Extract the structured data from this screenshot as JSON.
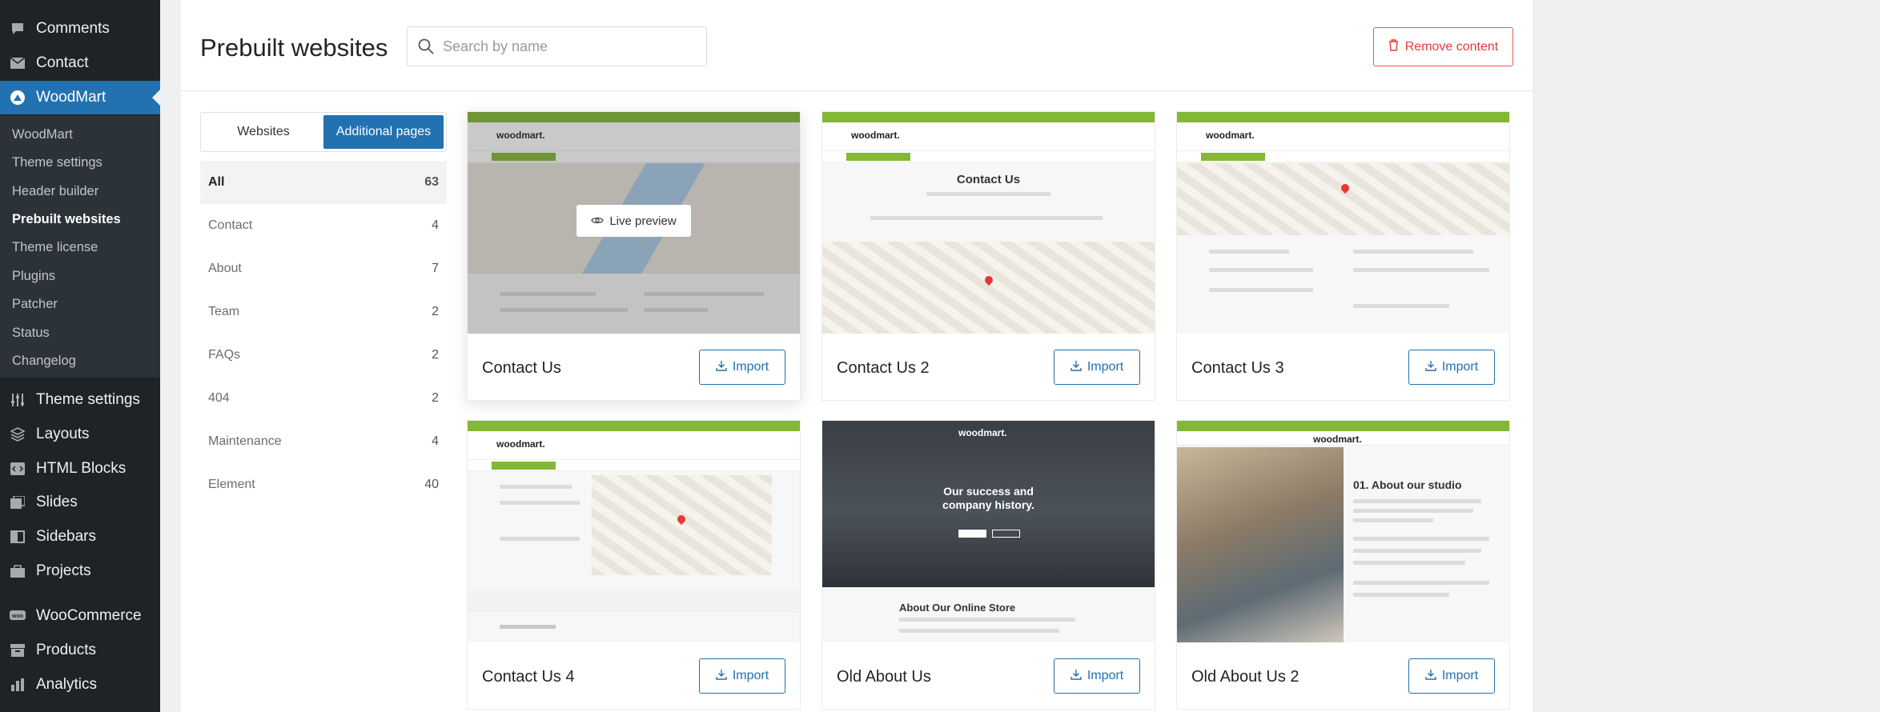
{
  "wp_menu": {
    "top_items": [
      {
        "label": "Comments",
        "icon": "comment-icon"
      },
      {
        "label": "Contact",
        "icon": "mail-icon"
      },
      {
        "label": "WoodMart",
        "icon": "woodmart-icon"
      }
    ],
    "submenu": [
      "WoodMart",
      "Theme settings",
      "Header builder",
      "Prebuilt websites",
      "Theme license",
      "Plugins",
      "Patcher",
      "Status",
      "Changelog"
    ],
    "current_submenu": "Prebuilt websites",
    "bottom_items": [
      {
        "label": "Theme settings",
        "icon": "sliders-icon"
      },
      {
        "label": "Layouts",
        "icon": "layers-icon"
      },
      {
        "label": "HTML Blocks",
        "icon": "code-block-icon"
      },
      {
        "label": "Slides",
        "icon": "slides-icon"
      },
      {
        "label": "Sidebars",
        "icon": "sidebar-icon"
      },
      {
        "label": "Projects",
        "icon": "projects-icon"
      },
      {
        "label": "WooCommerce",
        "icon": "woocommerce-icon"
      },
      {
        "label": "Products",
        "icon": "archive-icon"
      },
      {
        "label": "Analytics",
        "icon": "bar-chart-icon"
      }
    ]
  },
  "header": {
    "title": "Prebuilt websites",
    "search_placeholder": "Search by name",
    "remove_label": "Remove content"
  },
  "tabs": [
    {
      "label": "Websites",
      "active": false
    },
    {
      "label": "Additional pages",
      "active": true
    }
  ],
  "categories": [
    {
      "label": "All",
      "count": "63"
    },
    {
      "label": "Contact",
      "count": "4"
    },
    {
      "label": "About",
      "count": "7"
    },
    {
      "label": "Team",
      "count": "2"
    },
    {
      "label": "FAQs",
      "count": "2"
    },
    {
      "label": "404",
      "count": "2"
    },
    {
      "label": "Maintenance",
      "count": "4"
    },
    {
      "label": "Element",
      "count": "40"
    }
  ],
  "cards": [
    {
      "title": "Contact Us",
      "import_label": "Import",
      "preview_label": "Live preview",
      "thumb_logo": "woodmart."
    },
    {
      "title": "Contact Us 2",
      "import_label": "Import",
      "thumb_logo": "woodmart.",
      "thumb_heading": "Contact Us"
    },
    {
      "title": "Contact Us 3",
      "import_label": "Import",
      "thumb_logo": "woodmart."
    },
    {
      "title": "Contact Us 4",
      "import_label": "Import",
      "thumb_logo": "woodmart."
    },
    {
      "title": "Old About Us",
      "import_label": "Import",
      "thumb_logo": "woodmart.",
      "thumb_heading": "Our success and company history.",
      "thumb_subheading": "About Our Online Store"
    },
    {
      "title": "Old About Us 2",
      "import_label": "Import",
      "thumb_logo": "woodmart.",
      "thumb_heading": "01. About our studio"
    }
  ],
  "colors": {
    "accent": "#2271b1",
    "danger": "#e03c3c",
    "brand_green": "#83b735",
    "sidebar_bg": "#1d2327"
  }
}
